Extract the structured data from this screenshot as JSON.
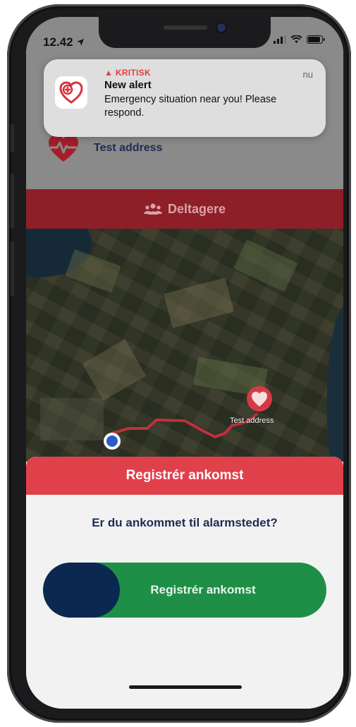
{
  "status_bar": {
    "time": "12.42"
  },
  "notification": {
    "level": "KRITISK",
    "title": "New alert",
    "body": "Emergency situation near you! Please respond.",
    "time": "nu",
    "app_icon": "heart-cross-icon"
  },
  "alarm": {
    "address": "Test address"
  },
  "tabs": {
    "participants_label": "Deltagere",
    "participants_icon": "people-icon"
  },
  "map": {
    "destination_label": "Test address",
    "destination_icon": "heart-pin-icon",
    "user_marker": "current-location-dot"
  },
  "sheet": {
    "title": "Registrér ankomst",
    "question": "Er du ankommet til alarmstedet?",
    "slider_label": "Registrér ankomst",
    "slider_progress": 0.27
  },
  "colors": {
    "accent_red": "#e0404a",
    "dark_red": "#8e1f28",
    "navy": "#0b2850",
    "green": "#1f8f47",
    "route": "#c0303a"
  }
}
